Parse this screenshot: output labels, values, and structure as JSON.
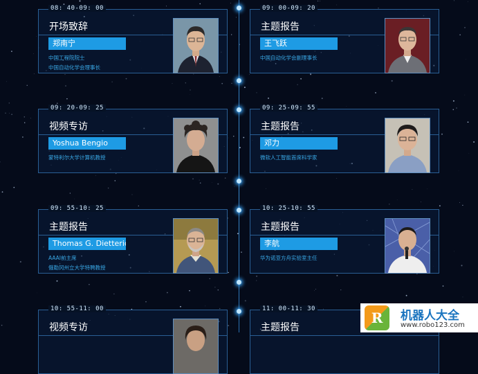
{
  "sessions": [
    {
      "time": "08: 40-09: 00",
      "title": "开场致辞",
      "name": "郑南宁",
      "desc": [
        "中国工程院院士",
        "中国自动化学会理事长"
      ]
    },
    {
      "time": "09: 00-09: 20",
      "title": "主题报告",
      "name": "王飞跃",
      "desc": [
        "中国自动化学会副理事长"
      ]
    },
    {
      "time": "09: 20-09: 25",
      "title": "视频专访",
      "name": "Yoshua Bengio",
      "desc": [
        "蒙特利尔大学计算机教授"
      ]
    },
    {
      "time": "09: 25-09: 55",
      "title": "主题报告",
      "name": "邓力",
      "desc": [
        "微软人工智能首席科学家"
      ]
    },
    {
      "time": "09: 55-10: 25",
      "title": "主题报告",
      "name": "Thomas G. Dietterich",
      "desc": [
        "AAAI前主席",
        "俄勒冈州立大学特聘教授"
      ]
    },
    {
      "time": "10: 25-10: 55",
      "title": "主题报告",
      "name": "李航",
      "desc": [
        "华为诺亚方舟实验室主任"
      ]
    },
    {
      "time": "10: 55-11: 00",
      "title": "视频专访",
      "name": "",
      "desc": []
    },
    {
      "time": "11: 00-11: 30",
      "title": "主题报告",
      "name": "",
      "desc": []
    }
  ],
  "watermark": {
    "logo_text": "R",
    "title": "机器人大全",
    "url": "www.robo123.com"
  },
  "colors": {
    "background": "#050b1a",
    "card_border": "#2a5f95",
    "name_tag": "#1e9be4",
    "desc_text": "#39a8e6"
  }
}
